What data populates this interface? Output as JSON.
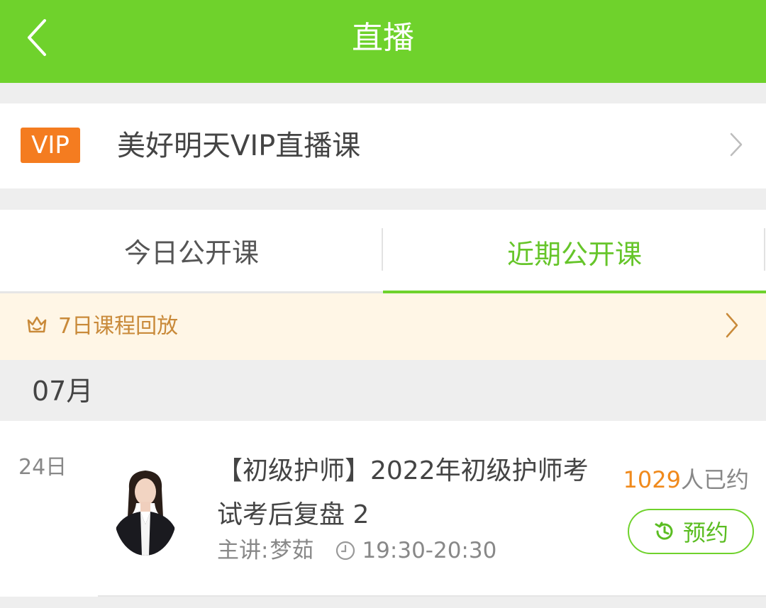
{
  "header": {
    "title": "直播",
    "back_icon": "chevron-left-icon",
    "color": "#6fd22c"
  },
  "vip": {
    "badge": "VIP",
    "title": "美好明天VIP直播课",
    "badge_color": "#f47c20"
  },
  "tabs": [
    {
      "label": "今日公开课",
      "active": false
    },
    {
      "label": "近期公开课",
      "active": true
    }
  ],
  "replay": {
    "label": "7日课程回放",
    "icon": "crown-icon",
    "color": "#c98a3a"
  },
  "month": "07月",
  "courses": [
    {
      "day": "24日",
      "title": "【初级护师】2022年初级护师考试考后复盘 2",
      "teacher_label": "主讲:",
      "teacher": "梦茹",
      "time": "19:30-20:30",
      "count": "1029",
      "count_suffix": "人已约",
      "button_label": "预约",
      "button_icon": "history-clock-icon"
    }
  ]
}
